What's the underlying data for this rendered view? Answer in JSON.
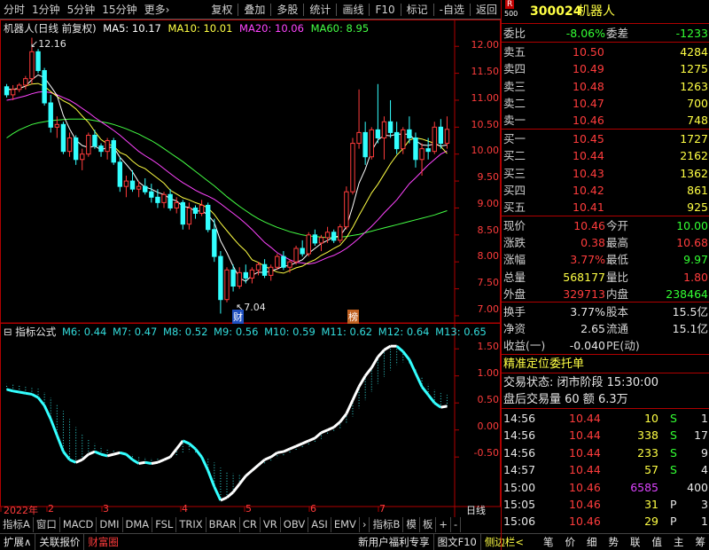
{
  "toolbar": {
    "left_items": [
      "分时",
      "1分钟",
      "5分钟",
      "15分钟",
      "更多›"
    ],
    "right_items": [
      "复权",
      "叠加",
      "多股",
      "统计",
      "画线",
      "F10",
      "标记",
      "-自选",
      "返回"
    ]
  },
  "chart": {
    "title": "机器人(日线 前复权)",
    "ma_labels": [
      {
        "text": "MA5: 10.17",
        "color": "#ffffff"
      },
      {
        "text": "MA10: 10.01",
        "color": "#ffff44"
      },
      {
        "text": "MA20: 10.06",
        "color": "#ff44ff"
      },
      {
        "text": "MA60: 8.95",
        "color": "#44ff44"
      }
    ],
    "high_marker": "12.16",
    "low_marker": "7.04",
    "marker_cai": "财",
    "marker_bang": "榜",
    "price_axis": [
      "12.00",
      "11.50",
      "11.00",
      "10.50",
      "10.00",
      "9.50",
      "9.00",
      "8.50",
      "8.00",
      "7.50",
      "7.00"
    ],
    "indicator_title": "指标公式",
    "indicator_labels": [
      {
        "text": "M6: 0.44",
        "color": "#33dddd"
      },
      {
        "text": "M7: 0.47",
        "color": "#33dddd"
      },
      {
        "text": "M8: 0.52",
        "color": "#33dddd"
      },
      {
        "text": "M9: 0.56",
        "color": "#33dddd"
      },
      {
        "text": "M10: 0.59",
        "color": "#33dddd"
      },
      {
        "text": "M11: 0.62",
        "color": "#33dddd"
      },
      {
        "text": "M12: 0.64",
        "color": "#33dddd"
      },
      {
        "text": "M13: 0.65",
        "color": "#33dddd"
      }
    ],
    "indicator_axis": [
      "1.50",
      "1.00",
      "0.50",
      "0.00",
      "-0.50"
    ],
    "date_axis": [
      "2022年",
      "2",
      "3",
      "4",
      "5",
      "6",
      "7"
    ],
    "period_label": "日线",
    "colors": {
      "up": "#ff3c3c",
      "down": "#33ffff",
      "ma5": "#ffffff",
      "ma10": "#ffff44",
      "ma20": "#ff44ff",
      "ma60": "#44ff44"
    }
  },
  "chart_data": {
    "type": "candlestick",
    "ylim": [
      6.9,
      12.3
    ],
    "ticks": [
      7.0,
      7.5,
      8.0,
      8.5,
      9.0,
      9.5,
      10.0,
      10.5,
      11.0,
      11.5,
      12.0
    ],
    "ohlc": [
      [
        11.25,
        11.3,
        11.05,
        11.1
      ],
      [
        11.1,
        11.28,
        11.0,
        11.2
      ],
      [
        11.2,
        11.32,
        11.15,
        11.28
      ],
      [
        11.28,
        11.45,
        11.2,
        11.4
      ],
      [
        11.4,
        12.16,
        11.3,
        11.9
      ],
      [
        11.9,
        11.95,
        11.5,
        11.55
      ],
      [
        11.55,
        11.6,
        10.9,
        10.95
      ],
      [
        10.95,
        11.1,
        10.4,
        10.5
      ],
      [
        10.5,
        10.7,
        10.3,
        10.55
      ],
      [
        10.55,
        10.6,
        10.0,
        10.05
      ],
      [
        10.05,
        10.4,
        9.95,
        10.3
      ],
      [
        10.3,
        10.35,
        9.8,
        9.9
      ],
      [
        9.9,
        10.1,
        9.7,
        10.0
      ],
      [
        10.0,
        10.4,
        9.95,
        10.35
      ],
      [
        10.35,
        10.45,
        10.1,
        10.15
      ],
      [
        10.15,
        10.2,
        9.95,
        10.05
      ],
      [
        10.05,
        10.3,
        9.9,
        10.25
      ],
      [
        10.25,
        10.3,
        9.8,
        9.85
      ],
      [
        9.85,
        9.95,
        9.3,
        9.4
      ],
      [
        9.4,
        9.6,
        9.2,
        9.5
      ],
      [
        9.5,
        9.7,
        9.3,
        9.35
      ],
      [
        9.35,
        9.5,
        9.2,
        9.4
      ],
      [
        9.4,
        9.55,
        9.25,
        9.3
      ],
      [
        9.3,
        9.45,
        9.1,
        9.2
      ],
      [
        9.2,
        9.35,
        9.0,
        9.1
      ],
      [
        9.1,
        9.3,
        9.0,
        9.25
      ],
      [
        9.25,
        9.35,
        8.95,
        9.0
      ],
      [
        9.0,
        9.2,
        8.9,
        9.1
      ],
      [
        9.1,
        9.15,
        8.6,
        8.7
      ],
      [
        8.7,
        9.1,
        8.6,
        9.0
      ],
      [
        9.0,
        9.05,
        8.8,
        8.9
      ],
      [
        8.9,
        9.15,
        8.85,
        9.05
      ],
      [
        9.05,
        9.1,
        8.55,
        8.6
      ],
      [
        8.6,
        8.8,
        8.0,
        8.1
      ],
      [
        8.1,
        8.2,
        7.04,
        7.3
      ],
      [
        7.3,
        7.9,
        7.25,
        7.85
      ],
      [
        7.85,
        7.95,
        7.45,
        7.55
      ],
      [
        7.55,
        7.9,
        7.5,
        7.8
      ],
      [
        7.8,
        7.95,
        7.6,
        7.7
      ],
      [
        7.7,
        7.9,
        7.6,
        7.85
      ],
      [
        7.85,
        8.0,
        7.75,
        7.95
      ],
      [
        7.95,
        8.05,
        7.7,
        7.75
      ],
      [
        7.75,
        7.95,
        7.65,
        7.9
      ],
      [
        7.9,
        8.15,
        7.85,
        8.1
      ],
      [
        8.1,
        8.2,
        7.85,
        7.9
      ],
      [
        7.9,
        8.05,
        7.8,
        8.0
      ],
      [
        8.0,
        8.3,
        7.95,
        8.25
      ],
      [
        8.25,
        8.4,
        8.1,
        8.15
      ],
      [
        8.15,
        8.55,
        8.1,
        8.5
      ],
      [
        8.5,
        8.6,
        8.3,
        8.35
      ],
      [
        8.35,
        8.5,
        8.2,
        8.45
      ],
      [
        8.45,
        8.65,
        8.35,
        8.55
      ],
      [
        8.55,
        8.6,
        8.35,
        8.4
      ],
      [
        8.4,
        8.7,
        8.35,
        8.65
      ],
      [
        8.65,
        9.4,
        8.6,
        9.3
      ],
      [
        9.3,
        10.3,
        9.25,
        10.2
      ],
      [
        10.2,
        11.2,
        10.1,
        10.4
      ],
      [
        10.4,
        10.6,
        9.8,
        9.95
      ],
      [
        9.95,
        10.5,
        9.9,
        10.45
      ],
      [
        10.45,
        11.3,
        10.2,
        10.3
      ],
      [
        10.3,
        10.7,
        9.9,
        10.6
      ],
      [
        10.6,
        11.0,
        10.3,
        10.4
      ],
      [
        10.4,
        10.6,
        10.0,
        10.1
      ],
      [
        10.1,
        10.5,
        10.0,
        10.45
      ],
      [
        10.45,
        10.7,
        10.2,
        10.3
      ],
      [
        10.3,
        10.4,
        9.75,
        9.9
      ],
      [
        9.9,
        10.2,
        9.6,
        10.1
      ],
      [
        10.1,
        10.3,
        9.9,
        10.05
      ],
      [
        10.05,
        10.6,
        10.0,
        10.5
      ],
      [
        10.5,
        10.65,
        10.1,
        10.2
      ],
      [
        10.2,
        10.7,
        10.1,
        10.46
      ]
    ],
    "ma5": [
      11.2,
      11.2,
      11.22,
      11.26,
      11.38,
      11.47,
      11.42,
      11.26,
      11.09,
      10.72,
      10.47,
      10.26,
      10.16,
      10.12,
      10.15,
      10.08,
      10.12,
      10.13,
      9.94,
      9.81,
      9.67,
      9.48,
      9.39,
      9.35,
      9.29,
      9.25,
      9.17,
      9.13,
      9.03,
      9.01,
      8.94,
      8.95,
      8.87,
      8.73,
      8.39,
      8.17,
      7.92,
      7.7,
      7.64,
      7.75,
      7.81,
      7.8,
      7.83,
      7.87,
      7.92,
      7.93,
      7.99,
      8.04,
      8.16,
      8.25,
      8.34,
      8.4,
      8.46,
      8.48,
      8.65,
      9.03,
      9.46,
      9.72,
      10.06,
      10.26,
      10.35,
      10.34,
      10.37,
      10.37,
      10.37,
      10.25,
      10.17,
      10.16,
      10.19,
      10.15,
      10.17
    ],
    "ma10": [
      11.2,
      11.2,
      11.22,
      11.26,
      11.3,
      11.31,
      11.26,
      11.16,
      11.07,
      10.99,
      10.93,
      10.84,
      10.71,
      10.59,
      10.42,
      10.27,
      10.19,
      10.15,
      10.03,
      9.98,
      9.87,
      9.78,
      9.73,
      9.64,
      9.55,
      9.46,
      9.33,
      9.26,
      9.19,
      9.15,
      9.1,
      9.06,
      9.0,
      8.88,
      8.72,
      8.58,
      8.44,
      8.31,
      8.2,
      8.04,
      7.99,
      7.92,
      7.86,
      7.81,
      7.79,
      7.84,
      7.89,
      7.92,
      7.99,
      8.04,
      8.12,
      8.18,
      8.25,
      8.31,
      8.45,
      8.64,
      8.86,
      9.07,
      9.28,
      9.44,
      9.63,
      9.82,
      9.98,
      10.1,
      10.26,
      10.3,
      10.28,
      10.24,
      10.2,
      10.14,
      10.01
    ],
    "ma20": [
      11.0,
      11.02,
      11.05,
      11.08,
      11.12,
      11.15,
      11.16,
      11.14,
      11.1,
      11.05,
      11.0,
      10.93,
      10.85,
      10.77,
      10.68,
      10.6,
      10.52,
      10.44,
      10.35,
      10.25,
      10.15,
      10.05,
      9.97,
      9.9,
      9.82,
      9.73,
      9.64,
      9.55,
      9.47,
      9.4,
      9.33,
      9.27,
      9.22,
      9.16,
      9.08,
      8.99,
      8.9,
      8.81,
      8.71,
      8.6,
      8.48,
      8.36,
      8.27,
      8.17,
      8.1,
      8.04,
      7.99,
      7.98,
      7.96,
      7.98,
      8.03,
      8.08,
      8.12,
      8.18,
      8.25,
      8.34,
      8.44,
      8.55,
      8.66,
      8.78,
      8.91,
      9.03,
      9.15,
      9.3,
      9.45,
      9.56,
      9.68,
      9.8,
      9.9,
      10.0,
      10.06
    ],
    "ma60": [
      10.3,
      10.38,
      10.45,
      10.5,
      10.55,
      10.58,
      10.6,
      10.62,
      10.63,
      10.64,
      10.65,
      10.65,
      10.65,
      10.64,
      10.62,
      10.6,
      10.58,
      10.55,
      10.51,
      10.47,
      10.42,
      10.37,
      10.31,
      10.25,
      10.18,
      10.1,
      10.02,
      9.94,
      9.86,
      9.77,
      9.68,
      9.59,
      9.5,
      9.41,
      9.31,
      9.21,
      9.12,
      9.03,
      8.95,
      8.87,
      8.8,
      8.74,
      8.69,
      8.64,
      8.6,
      8.56,
      8.53,
      8.5,
      8.48,
      8.47,
      8.46,
      8.45,
      8.45,
      8.46,
      8.47,
      8.49,
      8.51,
      8.54,
      8.57,
      8.6,
      8.63,
      8.66,
      8.69,
      8.72,
      8.75,
      8.78,
      8.81,
      8.84,
      8.87,
      8.91,
      8.95
    ],
    "indicator": {
      "ylim": [
        -1.35,
        1.75
      ],
      "ticks": [
        1.5,
        1.0,
        0.5,
        0.0,
        -0.5
      ],
      "m6": [
        0.75,
        0.72,
        0.7,
        0.68,
        0.66,
        0.6,
        0.45,
        0.2,
        -0.1,
        -0.4,
        -0.55,
        -0.6,
        -0.55,
        -0.45,
        -0.4,
        -0.45,
        -0.48,
        -0.45,
        -0.42,
        -0.45,
        -0.55,
        -0.62,
        -0.6,
        -0.62,
        -0.6,
        -0.55,
        -0.5,
        -0.35,
        -0.2,
        -0.25,
        -0.35,
        -0.5,
        -0.75,
        -1.05,
        -1.3,
        -1.25,
        -1.15,
        -1.0,
        -0.85,
        -0.75,
        -0.65,
        -0.55,
        -0.5,
        -0.42,
        -0.4,
        -0.35,
        -0.3,
        -0.25,
        -0.2,
        -0.15,
        -0.05,
        0.0,
        0.05,
        0.15,
        0.3,
        0.55,
        0.8,
        1.0,
        1.15,
        1.35,
        1.48,
        1.55,
        1.55,
        1.45,
        1.3,
        1.05,
        0.8,
        0.65,
        0.5,
        0.42,
        0.44
      ],
      "m13": [
        0.85,
        0.84,
        0.83,
        0.82,
        0.8,
        0.76,
        0.7,
        0.6,
        0.48,
        0.35,
        0.2,
        0.05,
        -0.08,
        -0.18,
        -0.25,
        -0.3,
        -0.34,
        -0.37,
        -0.39,
        -0.42,
        -0.45,
        -0.48,
        -0.5,
        -0.52,
        -0.53,
        -0.53,
        -0.52,
        -0.48,
        -0.42,
        -0.4,
        -0.42,
        -0.46,
        -0.52,
        -0.6,
        -0.7,
        -0.76,
        -0.8,
        -0.82,
        -0.8,
        -0.76,
        -0.7,
        -0.64,
        -0.58,
        -0.52,
        -0.47,
        -0.42,
        -0.37,
        -0.32,
        -0.27,
        -0.22,
        -0.16,
        -0.1,
        -0.04,
        0.03,
        0.12,
        0.25,
        0.4,
        0.55,
        0.7,
        0.85,
        0.98,
        1.1,
        1.2,
        1.25,
        1.22,
        1.12,
        0.98,
        0.85,
        0.75,
        0.68,
        0.65
      ]
    }
  },
  "quote": {
    "code": "300024",
    "name": "机器人",
    "r_badge": "R",
    "r_num": "500",
    "weibi_label": "委比",
    "weibi": "-8.06%",
    "weicha_label": "委差",
    "weicha": "-1233",
    "sell": [
      {
        "label": "卖五",
        "price": "10.50",
        "vol": "4284"
      },
      {
        "label": "卖四",
        "price": "10.49",
        "vol": "1275"
      },
      {
        "label": "卖三",
        "price": "10.48",
        "vol": "1263"
      },
      {
        "label": "卖二",
        "price": "10.47",
        "vol": "700"
      },
      {
        "label": "卖一",
        "price": "10.46",
        "vol": "748"
      }
    ],
    "buy": [
      {
        "label": "买一",
        "price": "10.45",
        "vol": "1727"
      },
      {
        "label": "买二",
        "price": "10.44",
        "vol": "2162"
      },
      {
        "label": "买三",
        "price": "10.43",
        "vol": "1362"
      },
      {
        "label": "买四",
        "price": "10.42",
        "vol": "861"
      },
      {
        "label": "买五",
        "price": "10.41",
        "vol": "925"
      }
    ],
    "stats": [
      {
        "l1": "现价",
        "v1": "10.46",
        "c1": "red",
        "l2": "今开",
        "v2": "10.00",
        "c2": "green"
      },
      {
        "l1": "涨跌",
        "v1": "0.38",
        "c1": "red",
        "l2": "最高",
        "v2": "10.68",
        "c2": "red"
      },
      {
        "l1": "涨幅",
        "v1": "3.77%",
        "c1": "red",
        "l2": "最低",
        "v2": "9.97",
        "c2": "green"
      },
      {
        "l1": "总量",
        "v1": "568177",
        "c1": "yellow",
        "l2": "量比",
        "v2": "1.80",
        "c2": "red"
      },
      {
        "l1": "外盘",
        "v1": "329713",
        "c1": "red",
        "l2": "内盘",
        "v2": "238464",
        "c2": "green"
      }
    ],
    "stats2": [
      {
        "l1": "换手",
        "v1": "3.77%",
        "l2": "股本",
        "v2": "15.5亿"
      },
      {
        "l1": "净资",
        "v1": "2.65",
        "l2": "流通",
        "v2": "15.1亿"
      },
      {
        "l1": "收益(一)",
        "v1": "-0.040",
        "l2": "PE(动)",
        "v2": ""
      }
    ],
    "precision_order": "精准定位委托单",
    "trade_status": "交易状态: 闭市阶段 15:30:00",
    "after_hours": "盘后交易量 60 额 6.3万",
    "ticks": [
      {
        "time": "14:56",
        "price": "10.44",
        "vol": "10",
        "vc": "yellow",
        "bs": "S",
        "bc": "green",
        "n": "1"
      },
      {
        "time": "14:56",
        "price": "10.44",
        "vol": "338",
        "vc": "yellow",
        "bs": "S",
        "bc": "green",
        "n": "17"
      },
      {
        "time": "14:56",
        "price": "10.44",
        "vol": "233",
        "vc": "yellow",
        "bs": "S",
        "bc": "green",
        "n": "9"
      },
      {
        "time": "14:57",
        "price": "10.44",
        "vol": "57",
        "vc": "yellow",
        "bs": "S",
        "bc": "green",
        "n": "4"
      },
      {
        "time": "15:00",
        "price": "10.46",
        "vol": "6585",
        "vc": "magenta",
        "bs": "",
        "bc": "white",
        "n": "400"
      },
      {
        "time": "15:05",
        "price": "10.46",
        "vol": "31",
        "vc": "yellow",
        "bs": "P",
        "bc": "white",
        "n": "3"
      },
      {
        "time": "15:06",
        "price": "10.46",
        "vol": "29",
        "vc": "yellow",
        "bs": "P",
        "bc": "white",
        "n": "1"
      }
    ]
  },
  "tabs1": [
    "指标A",
    "窗口",
    "MACD",
    "DMI",
    "DMA",
    "FSL",
    "TRIX",
    "BRAR",
    "CR",
    "VR",
    "OBV",
    "ASI",
    "EMV",
    "›",
    "指标B",
    "模",
    "板",
    "+",
    "-"
  ],
  "tabs2_left": [
    "扩展∧",
    "关联报价",
    "财富圈"
  ],
  "tabs2_mid": [
    "新用户福利专享",
    "图文F10",
    "侧边栏<"
  ],
  "tabs2_right": [
    "笔",
    "价",
    "细",
    "势",
    "联",
    "值",
    "主",
    "筹"
  ]
}
